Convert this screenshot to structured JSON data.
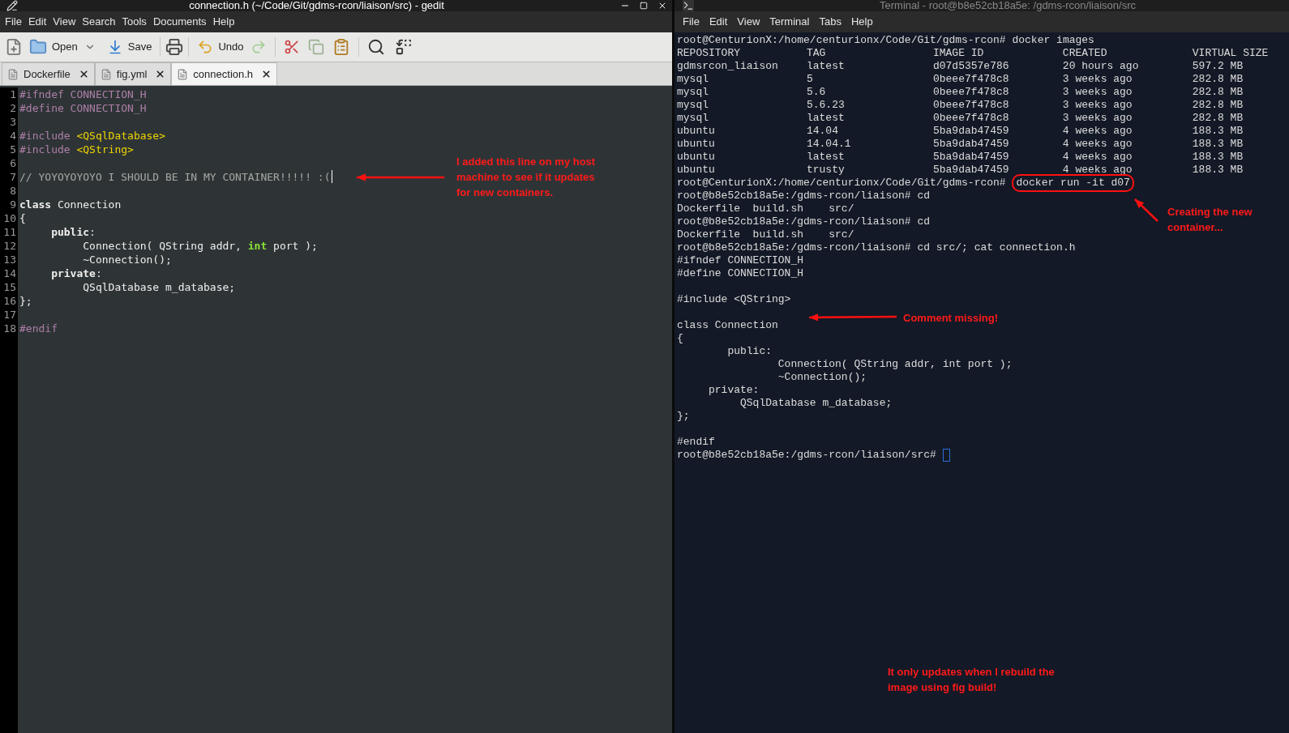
{
  "editor": {
    "title": "connection.h (~/Code/Git/gdms-rcon/liaison/src) - gedit",
    "menu": [
      "File",
      "Edit",
      "View",
      "Search",
      "Tools",
      "Documents",
      "Help"
    ],
    "toolbar": {
      "open": "Open",
      "save": "Save",
      "undo": "Undo"
    },
    "tabs": [
      {
        "label": "Dockerfile",
        "selected": false
      },
      {
        "label": "fig.yml",
        "selected": false
      },
      {
        "label": "connection.h",
        "selected": true
      }
    ],
    "lines": [
      {
        "number": "1",
        "segments": [
          {
            "text": "#ifndef CONNECTION_H",
            "kind": "preproc"
          }
        ]
      },
      {
        "number": "2",
        "segments": [
          {
            "text": "#define CONNECTION_H",
            "kind": "preproc"
          }
        ]
      },
      {
        "number": "3"
      },
      {
        "number": "4",
        "segments": [
          {
            "text": "#include ",
            "kind": "preproc"
          },
          {
            "text": "<QSqlDatabase>",
            "kind": "string"
          }
        ]
      },
      {
        "number": "5",
        "segments": [
          {
            "text": "#include ",
            "kind": "preproc"
          },
          {
            "text": "<QString>",
            "kind": "string"
          }
        ]
      },
      {
        "number": "6"
      },
      {
        "number": "7",
        "segments": [
          {
            "text": "// YOYOYOYOYO I SHOULD BE IN MY CONTAINER!!!!! :(",
            "kind": "comment"
          }
        ],
        "cursor": true
      },
      {
        "number": "8"
      },
      {
        "number": "9",
        "segments": [
          {
            "text": "class",
            "kind": "keyword"
          },
          {
            "text": " Connection",
            "kind": "plain"
          }
        ]
      },
      {
        "number": "10",
        "segments": [
          {
            "text": "{",
            "kind": "plain"
          }
        ]
      },
      {
        "number": "11",
        "segments": [
          {
            "text": "     public",
            "kind": "keyword"
          },
          {
            "text": ":",
            "kind": "plain"
          }
        ]
      },
      {
        "number": "12",
        "segments": [
          {
            "text": "          Connection( QString addr, ",
            "kind": "plain"
          },
          {
            "text": "int",
            "kind": "type"
          },
          {
            "text": " port );",
            "kind": "plain"
          }
        ]
      },
      {
        "number": "13",
        "segments": [
          {
            "text": "          ~Connection();",
            "kind": "plain"
          }
        ]
      },
      {
        "number": "14",
        "segments": [
          {
            "text": "     private",
            "kind": "keyword"
          },
          {
            "text": ":",
            "kind": "plain"
          }
        ]
      },
      {
        "number": "15",
        "segments": [
          {
            "text": "          QSqlDatabase m_database;",
            "kind": "plain"
          }
        ]
      },
      {
        "number": "16",
        "segments": [
          {
            "text": "};",
            "kind": "plain"
          }
        ]
      },
      {
        "number": "17"
      },
      {
        "number": "18",
        "segments": [
          {
            "text": "#endif",
            "kind": "preproc"
          }
        ]
      }
    ]
  },
  "terminal": {
    "title": "Terminal - root@b8e52cb18a5e: /gdms-rcon/liaison/src",
    "menu": [
      "File",
      "Edit",
      "View",
      "Terminal",
      "Tabs",
      "Help"
    ],
    "lines": [
      {
        "kind": "command",
        "prompt": "root@CenturionX:/home/centurionx/Code/Git/gdms-rcon#",
        "command": "docker images",
        "circled": false,
        "cursor": false
      },
      {
        "kind": "table",
        "columns": [
          "REPOSITORY",
          "TAG",
          "IMAGE ID",
          "CREATED",
          "VIRTUAL SIZE"
        ],
        "rows": [
          [
            "gdmsrcon_liaison",
            "latest",
            "d07d5357e786",
            "20 hours ago",
            "597.2 MB"
          ],
          [
            "mysql",
            "5",
            "0beee7f478c8",
            "3 weeks ago",
            "282.8 MB"
          ],
          [
            "mysql",
            "5.6",
            "0beee7f478c8",
            "3 weeks ago",
            "282.8 MB"
          ],
          [
            "mysql",
            "5.6.23",
            "0beee7f478c8",
            "3 weeks ago",
            "282.8 MB"
          ],
          [
            "mysql",
            "latest",
            "0beee7f478c8",
            "3 weeks ago",
            "282.8 MB"
          ],
          [
            "ubuntu",
            "14.04",
            "5ba9dab47459",
            "4 weeks ago",
            "188.3 MB"
          ],
          [
            "ubuntu",
            "14.04.1",
            "5ba9dab47459",
            "4 weeks ago",
            "188.3 MB"
          ],
          [
            "ubuntu",
            "latest",
            "5ba9dab47459",
            "4 weeks ago",
            "188.3 MB"
          ],
          [
            "ubuntu",
            "trusty",
            "5ba9dab47459",
            "4 weeks ago",
            "188.3 MB"
          ]
        ]
      },
      {
        "kind": "command",
        "prompt": "root@CenturionX:/home/centurionx/Code/Git/gdms-rcon#",
        "command": "docker run -it d07",
        "circled": true,
        "cursor": false
      },
      {
        "kind": "command",
        "prompt": "root@b8e52cb18a5e:/gdms-rcon/liaison#",
        "command": "cd",
        "circled": false,
        "cursor": false
      },
      {
        "kind": "output",
        "text": "Dockerfile  build.sh    src/"
      },
      {
        "kind": "command",
        "prompt": "root@b8e52cb18a5e:/gdms-rcon/liaison#",
        "command": "cd",
        "circled": false,
        "cursor": false
      },
      {
        "kind": "output",
        "text": "Dockerfile  build.sh    src/"
      },
      {
        "kind": "command",
        "prompt": "root@b8e52cb18a5e:/gdms-rcon/liaison#",
        "command": "cd src/; cat connection.h",
        "circled": false,
        "cursor": false
      },
      {
        "kind": "output",
        "text": "#ifndef CONNECTION_H"
      },
      {
        "kind": "output",
        "text": "#define CONNECTION_H"
      },
      {
        "kind": "blank"
      },
      {
        "kind": "output",
        "text": "#include <QString>"
      },
      {
        "kind": "blank"
      },
      {
        "kind": "output",
        "text": "class Connection"
      },
      {
        "kind": "output",
        "text": "{"
      },
      {
        "kind": "output",
        "text": "        public:"
      },
      {
        "kind": "output",
        "text": "                Connection( QString addr, int port );"
      },
      {
        "kind": "output",
        "text": "                ~Connection();"
      },
      {
        "kind": "output",
        "text": "     private:"
      },
      {
        "kind": "output",
        "text": "          QSqlDatabase m_database;"
      },
      {
        "kind": "output",
        "text": "};"
      },
      {
        "kind": "blank"
      },
      {
        "kind": "output",
        "text": "#endif"
      },
      {
        "kind": "command",
        "prompt": "root@b8e52cb18a5e:/gdms-rcon/liaison/src#",
        "circled": false,
        "cursor": true
      }
    ]
  },
  "annotations": [
    {
      "text": "I added this line on my host\nmachine to see if it updates\nfor new containers."
    },
    {
      "text": "Creating the new\ncontainer..."
    },
    {
      "text": "Comment missing!"
    },
    {
      "text": "It only updates when I rebuild the\nimage using fig build!"
    }
  ]
}
